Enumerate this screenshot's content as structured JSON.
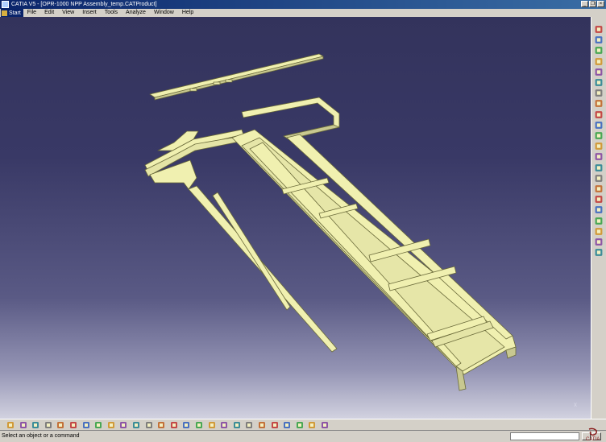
{
  "window": {
    "title": "CATIA V5 - [OPR-1000 NPP Assembly_temp.CATProduct]",
    "minimize_glyph": "_",
    "restore_glyph": "❐",
    "close_glyph": "×"
  },
  "menubar": {
    "start": "Start",
    "items": [
      "File",
      "Edit",
      "View",
      "Insert",
      "Tools",
      "Analyze",
      "Window",
      "Help"
    ]
  },
  "viewport": {
    "background_top": "#33335c",
    "background_bottom": "#d2d2e0",
    "model_color": "#f0f0b0",
    "model_edge_color": "#6a6a3a",
    "compass_label": "x"
  },
  "right_toolbar": {
    "icons": [
      "select-arrow-icon",
      "compass-icon",
      "product-icon",
      "component-icon",
      "part-icon",
      "existing-component-icon",
      "replace-component-icon",
      "graph-tree-icon",
      "manipulate-icon",
      "snap-icon",
      "explode-icon",
      "clash-icon",
      "constraint-icon",
      "fix-icon",
      "contact-icon",
      "offset-icon",
      "angle-icon",
      "update-icon",
      "scene-icon",
      "catalog-icon",
      "light-bulb-icon",
      "delete-icon"
    ]
  },
  "bottom_toolbar": {
    "icons": [
      "new-icon",
      "open-icon",
      "save-icon",
      "print-icon",
      "cut-icon",
      "copy-icon",
      "paste-icon",
      "undo-icon",
      "redo-icon",
      "whats-this-icon",
      "formula-icon",
      "comment-icon",
      "catalog-browser-icon",
      "measure-icon",
      "apply-material-icon",
      "fly-mode-icon",
      "fit-all-icon",
      "pan-icon",
      "rotate-icon",
      "zoom-in-icon",
      "zoom-out-icon",
      "normal-view-icon",
      "isometric-view-icon",
      "shading-icon",
      "hide-show-icon",
      "swap-space-icon"
    ]
  },
  "status": {
    "message": "Select an object or a command",
    "command_input": ""
  },
  "logo": {
    "text": "CATIA"
  }
}
